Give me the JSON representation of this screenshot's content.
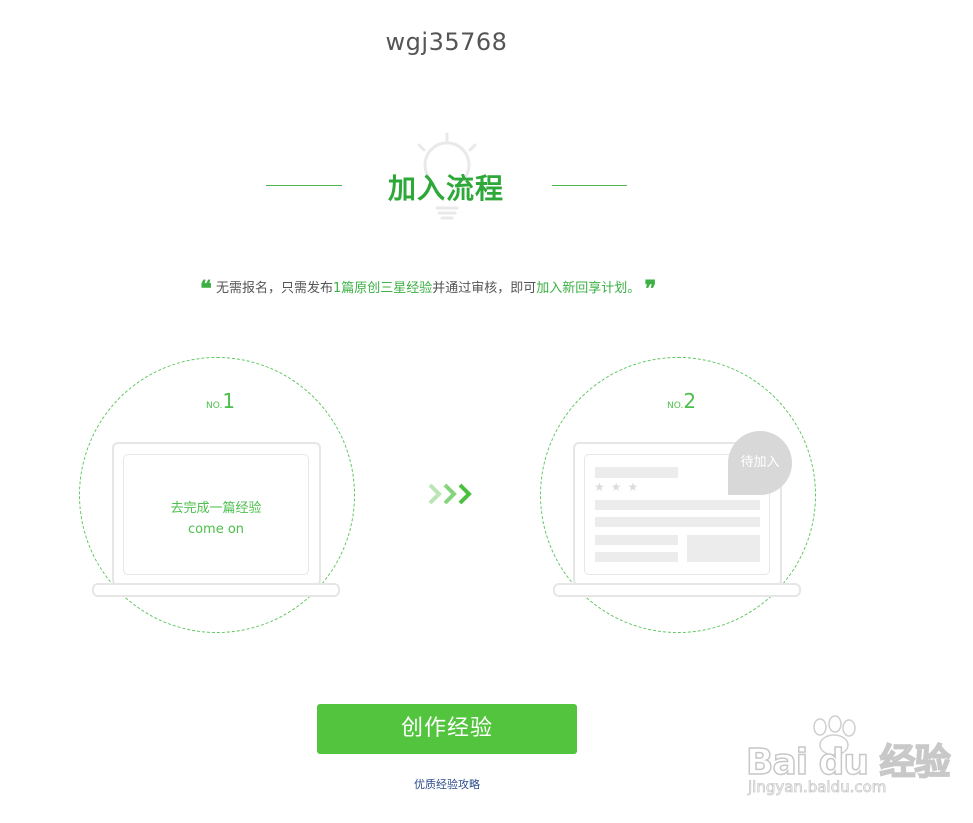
{
  "header": {
    "username": "wgj35768"
  },
  "section": {
    "title": "加入流程",
    "quote": {
      "open_mark": "❝",
      "part1": "无需报名，只需发布",
      "highlight1": "1篇原创三星经验",
      "part2": "并通过审核，即可",
      "highlight2": "加入新回享计划。",
      "close_mark": "❞"
    }
  },
  "steps": [
    {
      "no_label": "NO.",
      "number": "1",
      "line1": "去完成一篇经验",
      "line2": "come on"
    },
    {
      "no_label": "NO.",
      "number": "2",
      "badge": "待加入",
      "stars": "★★★"
    }
  ],
  "actions": {
    "create_button": "创作经验",
    "guide_link": "优质经验攻略"
  },
  "watermark": {
    "brand": "Bai du 经验",
    "url": "jingyan.baidu.com"
  },
  "colors": {
    "accent": "#3cb044",
    "button": "#53c43e",
    "link": "#2b4b8c"
  }
}
